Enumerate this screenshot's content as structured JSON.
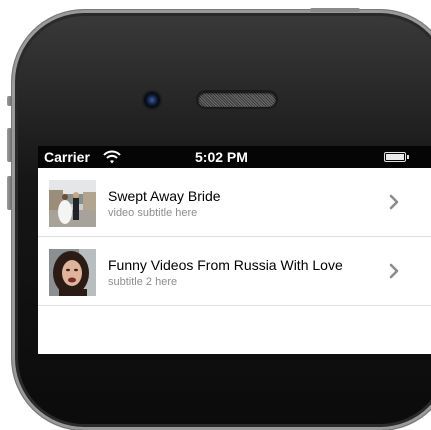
{
  "status_bar": {
    "carrier": "Carrier",
    "time": "5:02 PM",
    "wifi_icon": "wifi-icon",
    "battery_icon": "battery-icon"
  },
  "videos": [
    {
      "title": "Swept Away Bride",
      "subtitle": "video subtitle here",
      "thumbnail": "wedding-photo"
    },
    {
      "title": "Funny Videos From Russia With Love",
      "subtitle": "subtitle 2 here",
      "thumbnail": "woman-portrait-photo"
    }
  ],
  "colors": {
    "status_bar_bg": "#050505",
    "subtitle_text": "#8e8e8e",
    "separator": "#e0e0e0",
    "chevron": "#8c8c8c"
  }
}
